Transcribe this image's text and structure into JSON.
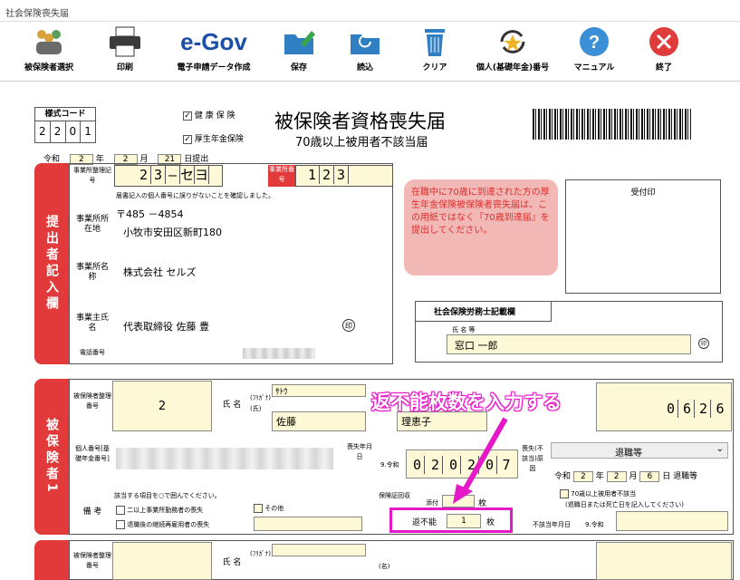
{
  "window": {
    "title": "社会保険喪失届"
  },
  "toolbar": {
    "items": [
      {
        "label": "被保険者選択"
      },
      {
        "label": "印刷"
      },
      {
        "label": "電子申請データ作成",
        "logo": "e-Gov"
      },
      {
        "label": "保存"
      },
      {
        "label": "読込"
      },
      {
        "label": "クリア"
      },
      {
        "label": "個人(基礎年金)番号"
      },
      {
        "label": "マニュアル"
      },
      {
        "label": "終了"
      }
    ]
  },
  "form": {
    "style_code_label": "様式コード",
    "style_code": [
      "2",
      "2",
      "0",
      "1"
    ],
    "check_health": "健 康 保 険",
    "check_pension": "厚生年金保険",
    "title": "被保険者資格喪失届",
    "subtitle": "70歳以上被用者不該当届",
    "date_era": "令和",
    "date_year": "2",
    "date_year_unit": "年",
    "date_month": "2",
    "date_month_unit": "月",
    "date_day": "21",
    "date_day_unit": "日提出",
    "office_code_label": "事業所整理記号",
    "office_code": [
      "2",
      "3",
      "—",
      "セ",
      "ヨ"
    ],
    "office_no_label": "事業所番号",
    "office_no": [
      "1",
      "2",
      "3"
    ],
    "submitter_section": "提出者記入欄",
    "confirm_text": "届書記入の個人番号に誤りがないことを確認しました。",
    "address_label": "事業所所在地",
    "postal": "〒485 －4854",
    "address": "小牧市安田区新町180",
    "office_name_label": "事業所名 称",
    "office_name": "株式会社 セルズ",
    "owner_label": "事業主氏 名",
    "owner_name": "代表取締役 佐藤 豊",
    "seal_mark": "印",
    "phone_label": "電話番号",
    "notice": "在職中に70歳に到達された方の厚生年金保険被保険者喪失届は、この用紙ではなく『70歳到達届』を提出してください。",
    "reception_label": "受付印",
    "sharoushi_label": "社会保険労務士記載欄",
    "sharoushi_name_label": "氏 名 等",
    "sharoushi_name": "窓口 一郎",
    "insured_section": "被保険者1",
    "insured_no_label": "被保険者整理番号",
    "insured_no": "2",
    "name_label": "氏 名",
    "furigana_label": "(ﾌﾘｶﾞﾅ)",
    "shi_label": "(氏)",
    "mei_label": "(名)",
    "kana_last": "ｻﾄｳ",
    "last_name": "佐藤",
    "first_name": "理恵子",
    "birth_digits": [
      "0",
      "6",
      "2",
      "6"
    ],
    "personal_no_label": "個人番号[基礎年金番号]",
    "loss_date_label": "喪失年月日",
    "loss_era": "9.令和",
    "loss_digits": [
      "0",
      "2",
      "0",
      "2",
      "0",
      "7"
    ],
    "loss_reason_label": "喪失(不該当)原因",
    "loss_reason_value": "退職等",
    "reason_era": "令和",
    "reason_year": "2",
    "reason_month": "2",
    "reason_day": "6",
    "reason_suffix": "日 退職等",
    "remarks_label": "備 考",
    "remarks_hint": "該当する項目を○で囲んでください。",
    "remark_opt1": "二以上事業所勤務者の喪失",
    "remark_opt2": "退職後の継続再雇用者の喪失",
    "remark_opt3": "その他",
    "card_collect_label": "保険証回収",
    "card_attached": "添付",
    "card_unit": "枚",
    "card_unreturn_label": "返不能",
    "card_unreturn_value": "1",
    "over70_label": "70歳以上被用者不該当",
    "over70_hint": "(退職日または死亡日を記入してください)",
    "over70_date_label": "不該当年月日",
    "over70_era": "9.令和",
    "row2_section": "",
    "annotation": "返不能枚数を入力する",
    "year_unit": "年",
    "month_unit": "月",
    "day_unit": "日"
  },
  "colors": {
    "section_red": "#e23a3a",
    "annotation_magenta": "#e619c8",
    "input_yellow": "#fdf9d6"
  }
}
